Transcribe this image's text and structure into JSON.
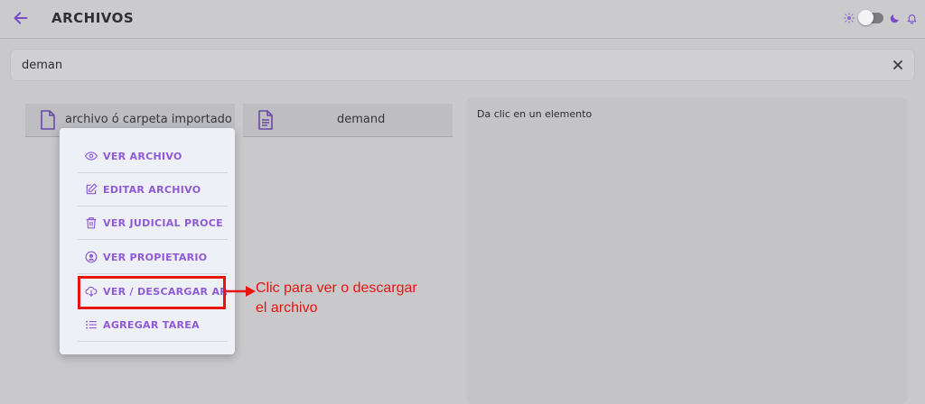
{
  "header": {
    "title": "ARCHIVOS",
    "icons": [
      "back-arrow-icon",
      "sun-icon",
      "moon-icon",
      "bell-icon"
    ],
    "theme_toggle_on": false
  },
  "search": {
    "value": "deman"
  },
  "files": [
    {
      "label": "archivo ó carpeta importado",
      "icon": "file-icon"
    },
    {
      "label": "demand",
      "icon": "file-text-icon"
    }
  ],
  "detail": {
    "placeholder": "Da clic en un elemento"
  },
  "menu": {
    "items": [
      {
        "label": "VER ARCHIVO",
        "icon": "eye-icon"
      },
      {
        "label": "EDITAR ARCHIVO",
        "icon": "edit-icon"
      },
      {
        "label": "VER JUDICIAL PROCE",
        "icon": "trash-icon"
      },
      {
        "label": "VER PROPIETARIO",
        "icon": "user-circle-icon"
      },
      {
        "label": "VER / DESCARGAR AR",
        "icon": "cloud-download-icon"
      },
      {
        "label": "AGREGAR TAREA",
        "icon": "list-icon"
      }
    ]
  },
  "annotation": {
    "line1": "Clic para ver o descargar",
    "line2": "el archivo"
  },
  "colors": {
    "accent": "#8f5ad6",
    "highlight": "#e8150f",
    "overlay_background": "#c9c9cc"
  }
}
